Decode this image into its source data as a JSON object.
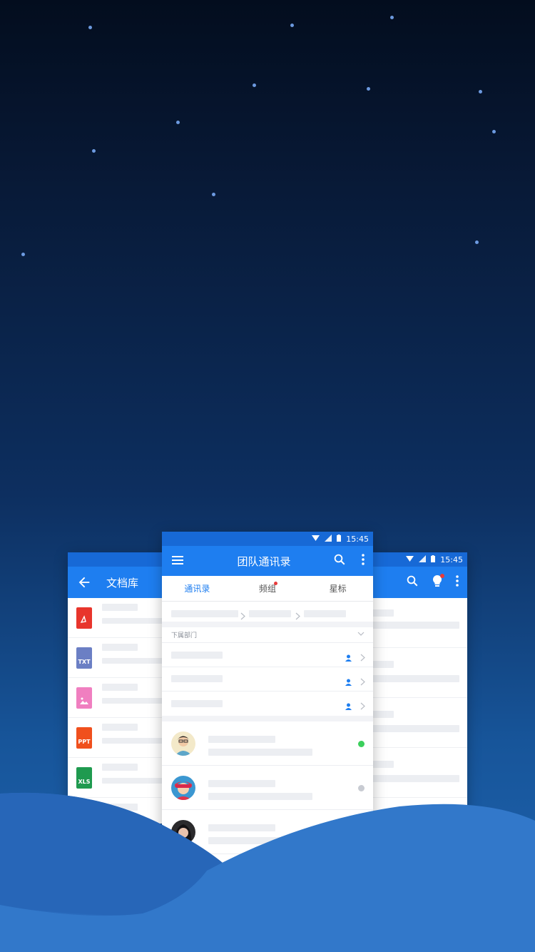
{
  "stars": true,
  "left_card": {
    "status": {
      "time": ""
    },
    "appbar": {
      "back_icon": "arrow-left-icon",
      "title": "文档库"
    },
    "files": [
      {
        "type": "pdf",
        "label": "",
        "color": "#e8352c"
      },
      {
        "type": "txt",
        "label": "TXT",
        "color": "#6b7fc4"
      },
      {
        "type": "image",
        "label": "",
        "color": "#f07fc0"
      },
      {
        "type": "ppt",
        "label": "PPT",
        "color": "#f0501d"
      },
      {
        "type": "xls",
        "label": "XLS",
        "color": "#1f9a4f"
      },
      {
        "type": "doc",
        "label": "",
        "color": "#3a7ff0"
      }
    ]
  },
  "right_card": {
    "status": {
      "time": "15:45"
    },
    "appbar": {
      "icons": [
        "search-icon",
        "bulb-icon",
        "more-icon"
      ]
    }
  },
  "center_card": {
    "status": {
      "time": "15:45"
    },
    "appbar": {
      "title": "团队通讯录",
      "menu_icon": "menu-icon",
      "search_icon": "search-icon",
      "more_icon": "more-icon"
    },
    "tabs": [
      {
        "label": "通讯录",
        "active": true,
        "badge": false
      },
      {
        "label": "频组",
        "active": false,
        "badge": true
      },
      {
        "label": "星标",
        "active": false,
        "badge": false
      }
    ],
    "section_title": "下属部门",
    "departments": 3,
    "members": [
      {
        "status_color": "#3ccf5c"
      },
      {
        "status_color": "#c8cbd2"
      },
      {
        "status_color": ""
      }
    ]
  },
  "colors": {
    "primary": "#1e7ef0",
    "statusbar": "#1769d6",
    "badge": "#e83a3a"
  }
}
